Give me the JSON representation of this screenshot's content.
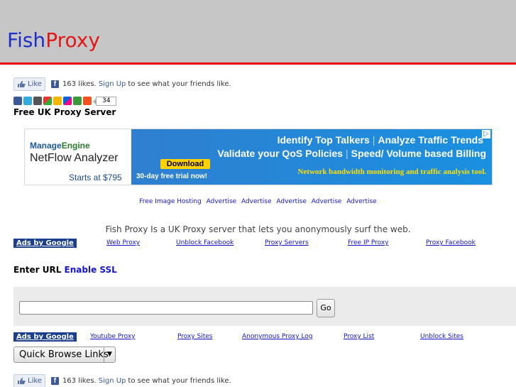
{
  "logo": {
    "part1": "Fish",
    "part2": "Proxy"
  },
  "like_bar": {
    "button": "Like",
    "count_text": "163 likes.",
    "signup": "Sign Up",
    "suffix": "to see what your friends like."
  },
  "share": {
    "count": "34"
  },
  "page_title": "Free UK Proxy Server",
  "banner": {
    "brand_a": "Manage",
    "brand_b": "Engine",
    "product": "NetFlow Analyzer",
    "price": "Starts at $795",
    "download": "Download",
    "trial": "30-day free trial now!",
    "line1a": "Identify Top Talkers",
    "line1b": "Analyze Traffic Trends",
    "line2a": "Validate your QoS Policies",
    "line2b": "Speed/ Volume based Billing",
    "line3": "Network bandwidth monitoring and traffic analysis tool.",
    "adchoice": "▷"
  },
  "top_links": [
    "Free Image Hosting",
    "Advertise",
    "Advertise",
    "Advertise",
    "Advertise",
    "Advertise"
  ],
  "description": "Fish Proxy Is a UK Proxy server that lets you anonymously surf the web.",
  "ads_row1": {
    "label": "Ads by Google",
    "links": [
      "Web Proxy",
      "Unblock Facebook",
      "Proxy Servers",
      "Free IP Proxy",
      "Proxy Facebook"
    ]
  },
  "enter_url": {
    "label": "Enter URL",
    "ssl": "Enable SSL"
  },
  "form": {
    "url_value": "",
    "go": "Go"
  },
  "ads_row2": {
    "label": "Ads by Google",
    "links": [
      "Youtube Proxy",
      "Proxy Sites",
      "Anonymous Proxy Log",
      "Proxy List",
      "Unblock Sites"
    ]
  },
  "quick_browse": {
    "selected": "Quick Browse Links"
  },
  "colors": {
    "header_bg": "#c6c6c6",
    "accent_red": "#e8000b",
    "logo_blue": "#1c2fc8",
    "link_blue": "#1515c8",
    "ads_label_bg": "#1a3e8c"
  }
}
